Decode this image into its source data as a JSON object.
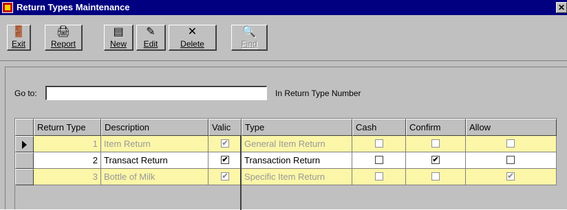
{
  "window": {
    "title": "Return Types Maintenance",
    "close_glyph": "✕"
  },
  "toolbar": {
    "buttons": [
      {
        "label": "Exit",
        "icon": "exit-door-icon"
      },
      {
        "label": "Report",
        "icon": "printer-icon"
      },
      {
        "label": "New",
        "icon": "new-record-icon"
      },
      {
        "label": "Edit",
        "icon": "edit-record-icon"
      },
      {
        "label": "Delete",
        "icon": "delete-x-icon"
      },
      {
        "label": "Find",
        "icon": "binoculars-icon",
        "disabled": true
      }
    ]
  },
  "goto": {
    "label": "Go to:",
    "value": "",
    "hint": "In Return Type Number"
  },
  "grid": {
    "columns": [
      "Return Type",
      "Description",
      "Valic",
      "Type",
      "Cash",
      "Confirm",
      "Allow"
    ],
    "rows": [
      {
        "number": "1",
        "description": "Item Return",
        "valid": true,
        "type": "General Item Return",
        "cash": false,
        "confirm": false,
        "allow": false,
        "current": true,
        "style": "hl"
      },
      {
        "number": "2",
        "description": "Transact Return",
        "valid": true,
        "type": "Transaction Return",
        "cash": false,
        "confirm": true,
        "allow": false,
        "current": false,
        "style": "norm"
      },
      {
        "number": "3",
        "description": "Bottle of Milk",
        "valid": true,
        "type": "Specific Item Return",
        "cash": false,
        "confirm": false,
        "allow": true,
        "current": false,
        "style": "hl"
      }
    ]
  },
  "colors": {
    "titlebar": "#000080",
    "highlight_row": "#fbf6a8",
    "face": "#c0c0c0"
  }
}
